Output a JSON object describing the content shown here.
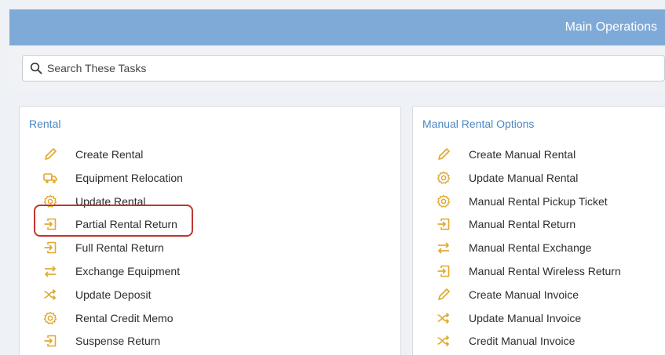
{
  "header": {
    "title": "Main Operations"
  },
  "search": {
    "placeholder": "Search These Tasks"
  },
  "colors": {
    "header": "#7faad8",
    "accent": "#4a86c4",
    "icon": "#e0a82e",
    "highlight": "#c0352f"
  },
  "rental": {
    "title": "Rental",
    "items": [
      {
        "label": "Create Rental",
        "icon": "pencil-icon"
      },
      {
        "label": "Equipment Relocation",
        "icon": "truck-icon"
      },
      {
        "label": "Update Rental",
        "icon": "gear-icon"
      },
      {
        "label": "Partial Rental Return",
        "icon": "return-icon"
      },
      {
        "label": "Full Rental Return",
        "icon": "return-icon"
      },
      {
        "label": "Exchange Equipment",
        "icon": "exchange-icon"
      },
      {
        "label": "Update Deposit",
        "icon": "shuffle-icon"
      },
      {
        "label": "Rental Credit Memo",
        "icon": "gear-icon"
      },
      {
        "label": "Suspense Return",
        "icon": "return-icon"
      }
    ]
  },
  "manual": {
    "title": "Manual Rental Options",
    "items": [
      {
        "label": "Create Manual Rental",
        "icon": "pencil-icon"
      },
      {
        "label": "Update Manual Rental",
        "icon": "gear-icon"
      },
      {
        "label": "Manual Rental Pickup Ticket",
        "icon": "gear-icon"
      },
      {
        "label": "Manual Rental Return",
        "icon": "return-icon"
      },
      {
        "label": "Manual Rental Exchange",
        "icon": "exchange-icon"
      },
      {
        "label": "Manual Rental Wireless Return",
        "icon": "return-icon"
      },
      {
        "label": "Create Manual Invoice",
        "icon": "pencil-icon"
      },
      {
        "label": "Update Manual Invoice",
        "icon": "shuffle-icon"
      },
      {
        "label": "Credit Manual Invoice",
        "icon": "shuffle-icon"
      }
    ]
  }
}
